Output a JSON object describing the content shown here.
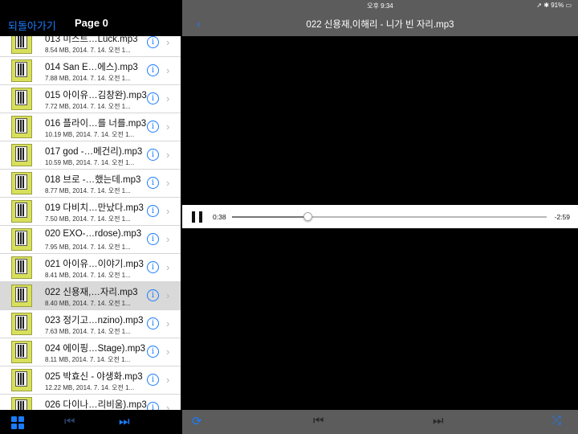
{
  "left": {
    "back_label": "되돌아가기",
    "page_title": "Page 0",
    "files": [
      {
        "name": "013 미스트…Luck.mp3",
        "meta": "8.54 MB, 2014. 7. 14. 오전 1...",
        "selected": false
      },
      {
        "name": "014 San E…에스).mp3",
        "meta": "7.88 MB, 2014. 7. 14. 오전 1...",
        "selected": false
      },
      {
        "name": "015 아이유…김창완).mp3",
        "meta": "7.72 MB, 2014. 7. 14. 오전 1...",
        "selected": false
      },
      {
        "name": "016 플라이…를 너를.mp3",
        "meta": "10.19 MB, 2014. 7. 14. 오전 1...",
        "selected": false
      },
      {
        "name": "017 god -…메건리).mp3",
        "meta": "10.59 MB, 2014. 7. 14. 오전 1...",
        "selected": false
      },
      {
        "name": "018 브로 -…했는데.mp3",
        "meta": "8.77 MB, 2014. 7. 14. 오전 1...",
        "selected": false
      },
      {
        "name": "019 다비치…만났다.mp3",
        "meta": "7.50 MB, 2014. 7. 14. 오전 1...",
        "selected": false
      },
      {
        "name": "020 EXO-…rdose).mp3",
        "meta": "7.95 MB, 2014. 7. 14. 오전 1...",
        "selected": false
      },
      {
        "name": "021 아이유…이야기.mp3",
        "meta": "8.41 MB, 2014. 7. 14. 오전 1...",
        "selected": false
      },
      {
        "name": "022 신용재,…자리.mp3",
        "meta": "8.40 MB, 2014. 7. 14. 오전 1...",
        "selected": true
      },
      {
        "name": "023 정기고…nzino).mp3",
        "meta": "7.63 MB, 2014. 7. 14. 오전 1...",
        "selected": false
      },
      {
        "name": "024 에이핑…Stage).mp3",
        "meta": "8.11 MB, 2014. 7. 14. 오전 1...",
        "selected": false
      },
      {
        "name": "025 박효신 - 야생화.mp3",
        "meta": "12.22 MB, 2014. 7. 14. 오전 1...",
        "selected": false
      },
      {
        "name": "026 다이나…리비움).mp3",
        "meta": "8.41 MB, 2014. 7. 14. 오전 1...",
        "selected": false
      }
    ]
  },
  "right": {
    "status_time": "오후 9:34",
    "status_battery": "91%",
    "track_title": "022 신용재,이해리 - 니가 빈 자리.mp3",
    "elapsed": "0:38",
    "remaining": "-2:59",
    "progress": 0.24
  },
  "icons": {
    "info": "i",
    "chevron": "›",
    "back": "‹",
    "prev": "⏮",
    "next": "⏭",
    "repeat": "⟳",
    "shuffle": "⤮"
  },
  "colors": {
    "accent": "#1a7cff",
    "panel": "#5c5c5c"
  }
}
